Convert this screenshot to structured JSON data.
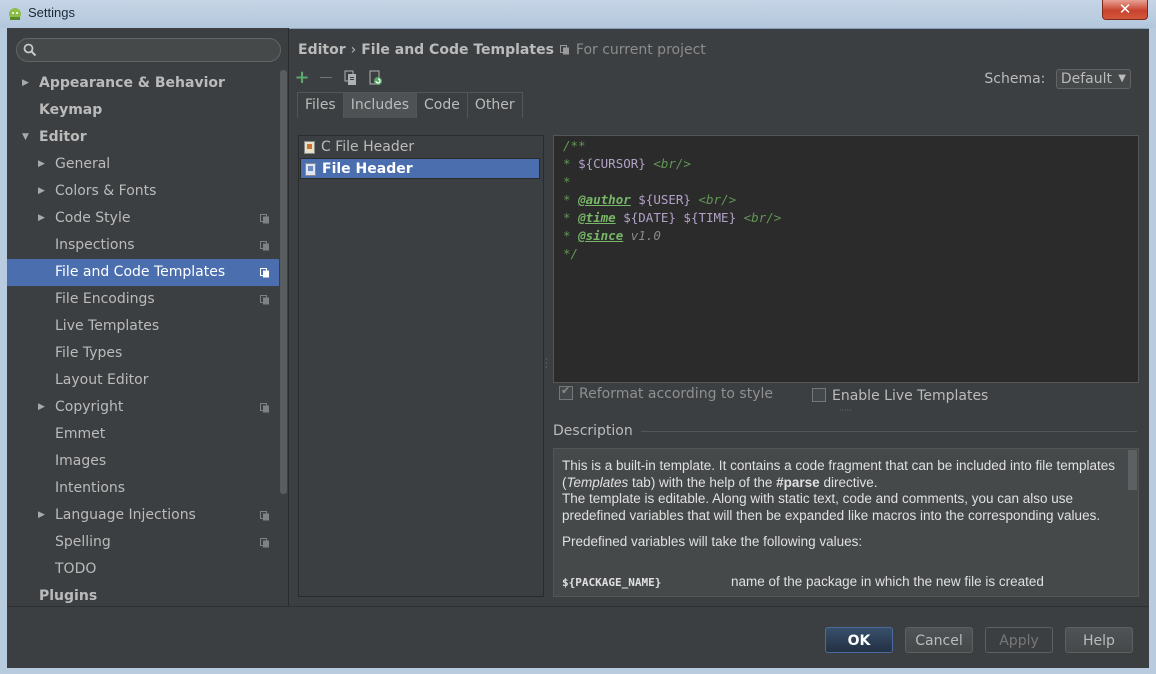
{
  "window": {
    "title": "Settings",
    "close_glyph": "✕"
  },
  "search": {
    "placeholder": "",
    "value": ""
  },
  "sidebar": {
    "items": [
      {
        "label": "Appearance & Behavior",
        "arrow": "▶",
        "bold": true
      },
      {
        "label": "Keymap",
        "bold": true
      },
      {
        "label": "Editor",
        "arrow": "▼",
        "bold": true
      },
      {
        "label": "General",
        "arrow": "▶"
      },
      {
        "label": "Colors & Fonts",
        "arrow": "▶"
      },
      {
        "label": "Code Style",
        "arrow": "▶",
        "project_icon": true
      },
      {
        "label": "Inspections",
        "project_icon": true
      },
      {
        "label": "File and Code Templates",
        "selected": true,
        "project_icon": true
      },
      {
        "label": "File Encodings",
        "project_icon": true
      },
      {
        "label": "Live Templates"
      },
      {
        "label": "File Types"
      },
      {
        "label": "Layout Editor"
      },
      {
        "label": "Copyright",
        "arrow": "▶",
        "project_icon": true
      },
      {
        "label": "Emmet"
      },
      {
        "label": "Images"
      },
      {
        "label": "Intentions"
      },
      {
        "label": "Language Injections",
        "arrow": "▶",
        "project_icon": true
      },
      {
        "label": "Spelling",
        "project_icon": true
      },
      {
        "label": "TODO"
      },
      {
        "label": "Plugins",
        "bold": true
      }
    ]
  },
  "breadcrumb": {
    "parent": "Editor",
    "separator": "›",
    "current": "File and Code Templates",
    "scope": "For current project"
  },
  "toolbar": {
    "add_glyph": "+",
    "remove_glyph": "—"
  },
  "schema": {
    "label": "Schema:",
    "value": "Default",
    "caret": "▼"
  },
  "tabs": [
    {
      "label": "Files"
    },
    {
      "label": "Includes",
      "active": true
    },
    {
      "label": "Code"
    },
    {
      "label": "Other"
    }
  ],
  "templates": [
    {
      "label": "C File Header"
    },
    {
      "label": "File Header",
      "selected": true
    }
  ],
  "editor": {
    "lines": {
      "l1": "/**",
      "l2_star": "* ",
      "l2_var": "${CURSOR}",
      "l2_br": " <br/>",
      "l3": "*",
      "l4_star": "* ",
      "l4_tag": "@author",
      "l4_var": " ${USER}",
      "l4_br": " <br/>",
      "l5_star": "* ",
      "l5_tag": "@time",
      "l5_var": " ${DATE} ${TIME}",
      "l5_br": " <br/>",
      "l6_star": "* ",
      "l6_tag": "@since",
      "l6_val": " v1.0",
      "l7": "*/"
    }
  },
  "options": {
    "reformat": {
      "label": "Reformat according to style",
      "checked": true
    },
    "live_templates": {
      "label": "Enable Live Templates",
      "checked": false
    }
  },
  "description": {
    "header": "Description",
    "p1_a": "This is a built-in template. It contains a code fragment that can be included into file templates (",
    "p1_em": "Templates",
    "p1_b": " tab) with the help of the ",
    "p1_strong": "#parse",
    "p1_c": " directive.",
    "p1_d": "The template is editable. Along with static text, code and comments, you can also use predefined variables that will then be expanded like macros into the corresponding values.",
    "p2": "Predefined variables will take the following values:",
    "var_name": "${PACKAGE_NAME}",
    "var_desc": "name of the package in which the new file is created"
  },
  "buttons": {
    "ok": "OK",
    "cancel": "Cancel",
    "apply": "Apply",
    "help": "Help"
  },
  "colors": {
    "selection": "#4b6eaf",
    "background": "#3c3f41",
    "editor_bg": "#2b2b2b",
    "comment": "#629755"
  }
}
